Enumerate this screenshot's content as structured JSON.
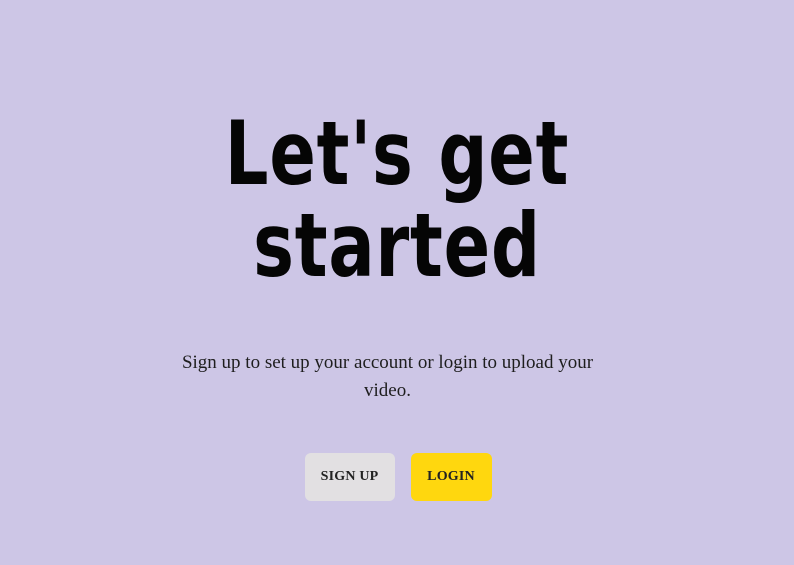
{
  "hero": {
    "title_line1": "Let's get",
    "title_line2": "started",
    "subtitle": "Sign up to set up your account or login to upload your video."
  },
  "actions": {
    "signup_label": "SIGN UP",
    "login_label": "LOGIN"
  },
  "colors": {
    "background": "#cdc6e6",
    "signup_button": "#e2e0e2",
    "login_button": "#ffd70e",
    "title_text": "#050505"
  }
}
